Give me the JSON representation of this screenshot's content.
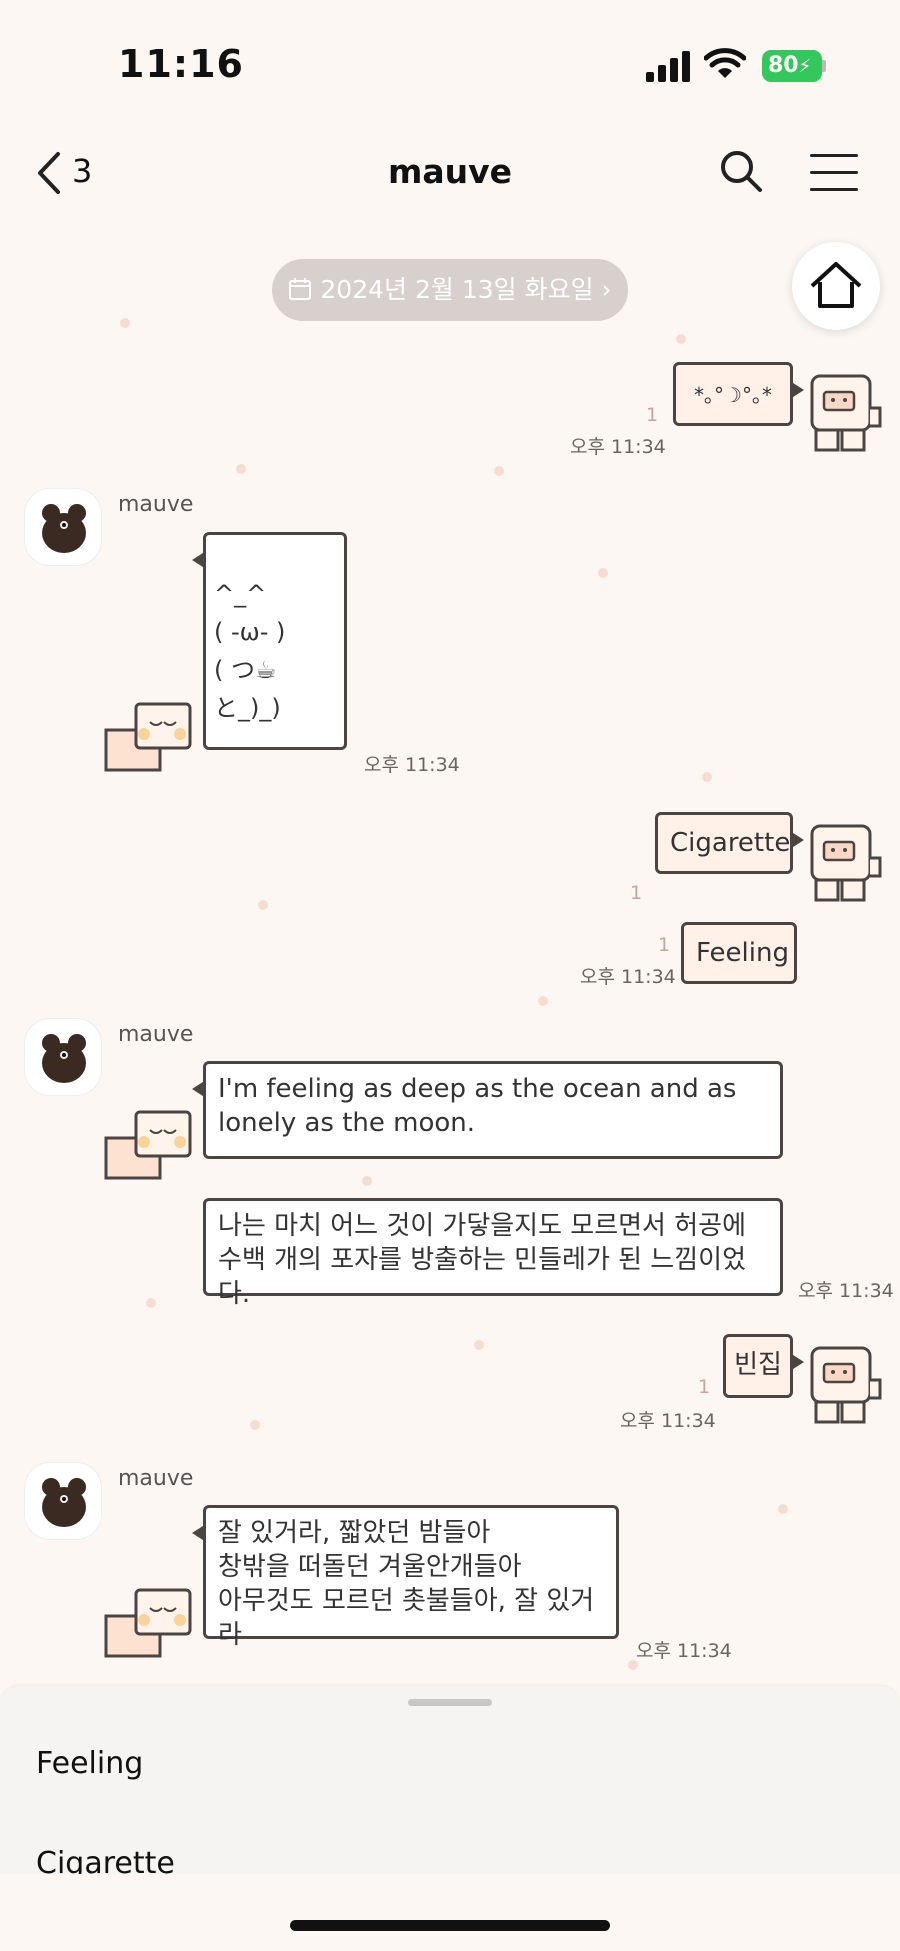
{
  "status_bar": {
    "time": "11:16",
    "battery": "80"
  },
  "nav": {
    "back_count": "3",
    "title": "mauve"
  },
  "date_pill": {
    "label": "2024년 2월 13일 화요일"
  },
  "chat": {
    "messages": [
      {
        "type": "sent",
        "text": "*｡°☽°｡*",
        "read": "1",
        "time": "오후 11:34"
      },
      {
        "type": "received",
        "sender": "mauve",
        "text": "^_^\n(   -ω- )\n( つ☕\nと_)_)",
        "time": "오후 11:34"
      },
      {
        "type": "sent",
        "text": "Cigarette",
        "read": "1"
      },
      {
        "type": "sent",
        "text": "Feeling",
        "read": "1",
        "time": "오후 11:34"
      },
      {
        "type": "received",
        "sender": "mauve",
        "text": "I'm feeling as deep as the ocean and as lonely as the moon."
      },
      {
        "type": "received",
        "text": "나는 마치 어느 것이 가닿을지도 모르면서 허공에 수백 개의 포자를 방출하는 민들레가 된 느낌이었다.",
        "time": "오후 11:34"
      },
      {
        "type": "sent",
        "text": "빈집",
        "read": "1",
        "time": "오후 11:34"
      },
      {
        "type": "received",
        "sender": "mauve",
        "text": "잘 있거라, 짧았던 밤들아\n창밖을 떠돌던 겨울안개들아\n아무것도 모르던 촛불들아, 잘 있거라",
        "time": "오후 11:34"
      }
    ]
  },
  "suggestions": {
    "items": [
      "Feeling",
      "Cigarette"
    ]
  },
  "icons": {
    "back": "chevron-left-icon",
    "search": "search-icon",
    "menu": "hamburger-menu-icon",
    "home": "home-icon",
    "calendar": "calendar-icon"
  },
  "colors": {
    "background": "#fdf7f3",
    "sent_bubble": "#fff1e8",
    "received_bubble": "#ffffff",
    "outline": "#4a4442",
    "battery": "#34c759"
  }
}
